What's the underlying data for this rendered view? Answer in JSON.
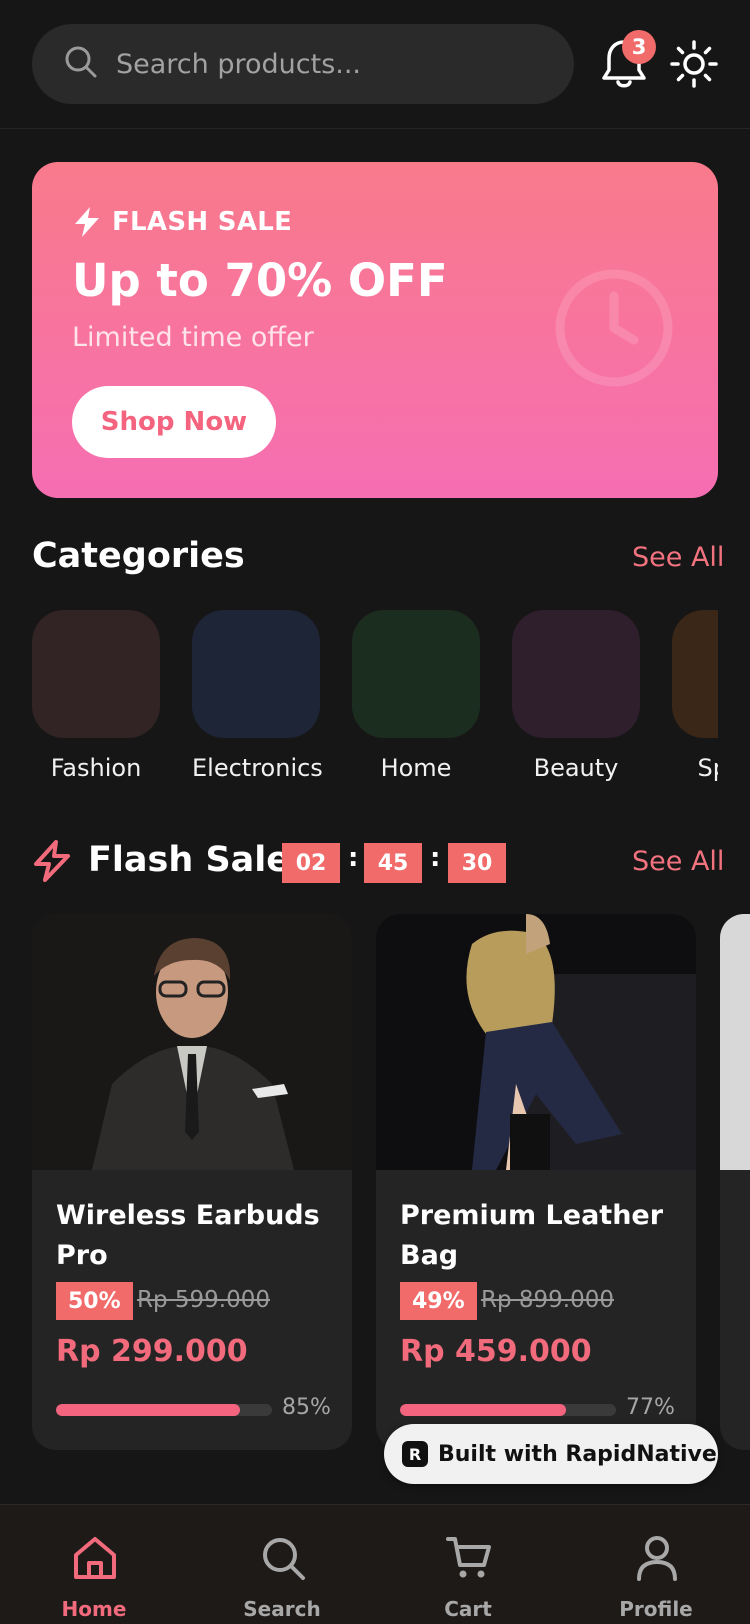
{
  "header": {
    "search_placeholder": "Search products...",
    "notification_count": "3"
  },
  "banner": {
    "tag": "FLASH SALE",
    "title": "Up to 70% OFF",
    "subtitle": "Limited time offer",
    "button": "Shop Now"
  },
  "categories": {
    "title": "Categories",
    "see_all": "See All",
    "items": [
      {
        "label": "Fashion",
        "color": "#322324"
      },
      {
        "label": "Electronics",
        "color": "#1d2537"
      },
      {
        "label": "Home",
        "color": "#1b2d1f"
      },
      {
        "label": "Beauty",
        "color": "#2f1e2b"
      },
      {
        "label": "Sports",
        "color": "#3a2718"
      }
    ]
  },
  "flash_sale": {
    "title": "Flash Sale",
    "see_all": "See All",
    "timer": {
      "hours": "02",
      "minutes": "45",
      "seconds": "30",
      "separator": ":"
    }
  },
  "products": [
    {
      "name": "Wireless Earbuds Pro",
      "discount": "50%",
      "old_price": "Rp 599.000",
      "price": "Rp 299.000",
      "sold_percent": 85,
      "sold_label": "85%"
    },
    {
      "name": "Premium Leather Bag",
      "discount": "49%",
      "old_price": "Rp 899.000",
      "price": "Rp 459.000",
      "sold_percent": 77,
      "sold_label": "77%"
    }
  ],
  "badge": {
    "logo": "R",
    "text": "Built with RapidNative"
  },
  "nav": [
    {
      "label": "Home",
      "icon": "home-icon",
      "active": true
    },
    {
      "label": "Search",
      "icon": "search-icon",
      "active": false
    },
    {
      "label": "Cart",
      "icon": "cart-icon",
      "active": false
    },
    {
      "label": "Profile",
      "icon": "profile-icon",
      "active": false
    }
  ],
  "colors": {
    "accent": "#f26b7d",
    "background": "#161616",
    "banner_top": "#f97a8b",
    "banner_bottom": "#f66eb2"
  }
}
